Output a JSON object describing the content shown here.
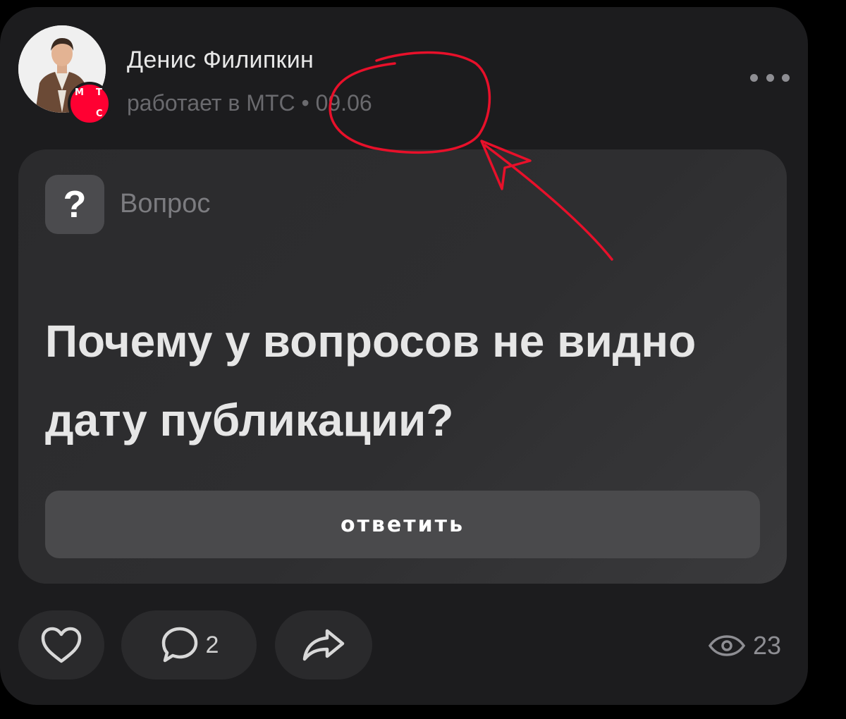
{
  "post": {
    "author": {
      "name": "Денис Филипкин",
      "meta": "работает в МТС • 09.06"
    },
    "badge": {
      "letters": [
        "М",
        "Т",
        "С"
      ]
    },
    "type_label": "Вопрос",
    "type_icon": "?",
    "title": "Почему у вопросов не видно дату публикации?",
    "answer_label": "ответить",
    "comments_count": "2",
    "views_count": "23"
  },
  "icons": {
    "more": "more-dots-icon",
    "like": "heart-icon",
    "comment": "comment-bubble-icon",
    "share": "share-arrow-icon",
    "views": "eye-icon"
  },
  "colors": {
    "card_bg": "#1c1c1e",
    "question_bg": "#2e2e30",
    "badge_red": "#ff0032",
    "annotation_red": "#e8102a"
  }
}
